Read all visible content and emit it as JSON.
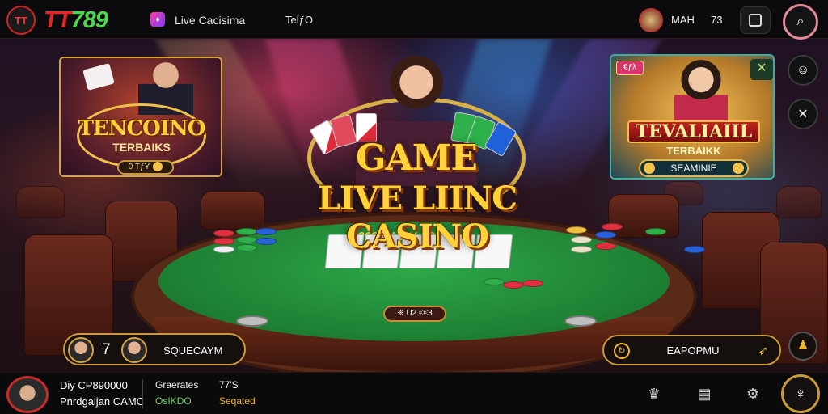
{
  "header": {
    "logo_mark": "TT",
    "logo_tt": "TT",
    "logo_num": "789",
    "nav_live_label": "Live Cacisima",
    "nav_other_label": "TelƒO",
    "user_name": "MAH",
    "user_value": "73",
    "search_icon": "search-icon"
  },
  "promo_left": {
    "title": "TENCOINO",
    "subtitle": "TERBAIKS",
    "button_label": "0 TƒY"
  },
  "promo_right": {
    "tag": "€ƒλ",
    "close_symbol": "✕",
    "title": "TEVALIAIIL",
    "subtitle": "TERBAIKK",
    "button_label": "SEAMINIE"
  },
  "hero": {
    "line1": "GAME",
    "line2": "LIVE LIINC CASINO",
    "felt_text": "2063I I UBY 8S3",
    "bet_label": "❈ U2 €€3"
  },
  "players": {
    "count": "7",
    "label": "SQUECAYM"
  },
  "export": {
    "label": "EAPOPMU",
    "icon": "refresh-icon"
  },
  "bottom": {
    "line1": "Diy CP890000",
    "line2": "Pnrdgaijan CAMC",
    "col2_top": "Graerates",
    "col2_bottom": "OsIKDO",
    "col3_top": "77'S",
    "col3_bottom": "Seqated"
  },
  "colors": {
    "brand_red": "#e52626",
    "brand_green": "#4ed64e",
    "gold": "#ffd23a",
    "felt": "#1d7e32"
  }
}
